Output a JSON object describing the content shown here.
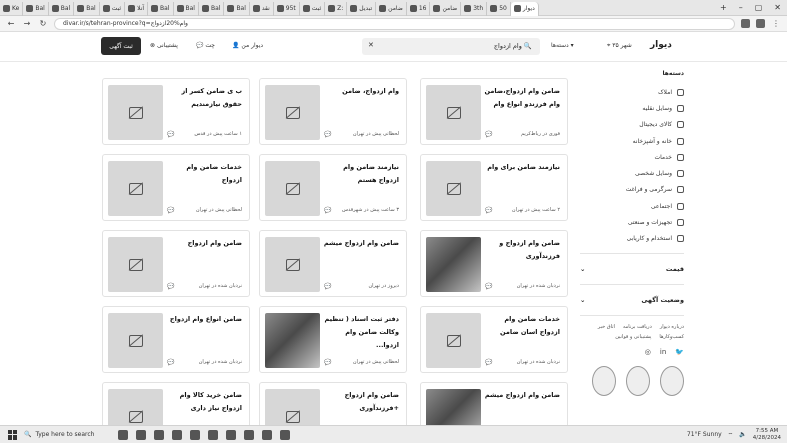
{
  "browser": {
    "tabs": [
      {
        "label": "Ke"
      },
      {
        "label": "Bal"
      },
      {
        "label": "Bal"
      },
      {
        "label": "Bal"
      },
      {
        "label": "ثبت"
      },
      {
        "label": "آنلا"
      },
      {
        "label": "Bal"
      },
      {
        "label": "Bal"
      },
      {
        "label": "Bal"
      },
      {
        "label": "Bal"
      },
      {
        "label": "نقد"
      },
      {
        "label": "95t"
      },
      {
        "label": "ثبت"
      },
      {
        "label": "Z:"
      },
      {
        "label": "تبدیل"
      },
      {
        "label": "ضامن"
      },
      {
        "label": "16"
      },
      {
        "label": "ضامن"
      },
      {
        "label": "3th"
      },
      {
        "label": "50"
      },
      {
        "label": "دیوار"
      }
    ],
    "url": "divar.ir/s/tehran-province?q=وام%20ازدواج"
  },
  "header": {
    "logo": "دیوار",
    "city": "۳۵ شهر",
    "categories": "دسته‌ها",
    "search_query": "وام ازدواج",
    "my_divar": "دیوار من",
    "chat": "چت",
    "support": "پشتیبانی",
    "post_ad": "ثبت آگهی"
  },
  "sidebar": {
    "title": "دسته‌ها",
    "categories": [
      {
        "label": "املاک",
        "icon": "home-icon"
      },
      {
        "label": "وسایل نقلیه",
        "icon": "car-icon"
      },
      {
        "label": "کالای دیجیتال",
        "icon": "phone-icon"
      },
      {
        "label": "خانه و آشپزخانه",
        "icon": "lamp-icon"
      },
      {
        "label": "خدمات",
        "icon": "brush-icon"
      },
      {
        "label": "وسایل شخصی",
        "icon": "watch-icon"
      },
      {
        "label": "سرگرمی و فراغت",
        "icon": "gamepad-icon"
      },
      {
        "label": "اجتماعی",
        "icon": "people-icon"
      },
      {
        "label": "تجهیزات و صنعتی",
        "icon": "chair-icon"
      },
      {
        "label": "استخدام و کاریابی",
        "icon": "briefcase-icon"
      }
    ],
    "filters": [
      {
        "label": "قیمت"
      },
      {
        "label": "وضعیت آگهی"
      }
    ],
    "footer_links": [
      "درباره دیوار",
      "دریافت برنامه",
      "اتاق خبر",
      "کسب‌وکارها",
      "پشتیبانی و قوانین"
    ]
  },
  "cards": [
    {
      "title": "ضامن وام ازدواج،ضامن وام فرزندو انواع وام",
      "meta": "فوری در رباط‌کریم",
      "has_image": false
    },
    {
      "title": "وام ازدواج، ضامن",
      "meta": "لحظاتی پیش در تهران",
      "has_image": false
    },
    {
      "title": "ب ی ضامن کسر از حقوق نیازمندیم",
      "meta": "۱ ساعت پیش در قدس",
      "has_image": false
    },
    {
      "title": "نیازمند ضامن برای وام",
      "meta": "۲ ساعت پیش در تهران",
      "has_image": false
    },
    {
      "title": "نیازمند ضامن وام ازدواج هستم",
      "meta": "۳ ساعت پیش در شهرقدس",
      "has_image": false
    },
    {
      "title": "خدمات ضامن وام ازدواج",
      "meta": "لحظاتی پیش در تهران",
      "has_image": false
    },
    {
      "title": "ضامن وام ازدواج و فرزندآوری",
      "meta": "نردبان شده در تهران",
      "has_image": true
    },
    {
      "title": "ضامن وام ازدواج میشم",
      "meta": "دیروز در تهران",
      "has_image": false
    },
    {
      "title": "ضامن وام ازدواج",
      "meta": "نردبان شده در تهران",
      "has_image": false
    },
    {
      "title": "خدمات ضامن وام ازدواج اسان ضامن",
      "meta": "نردبان شده در تهران",
      "has_image": false
    },
    {
      "title": "دفتر ثبت اسناد ( تنظیم وکالت ضامن وام ازدوا...",
      "meta": "لحظاتی پیش در تهران",
      "has_image": true
    },
    {
      "title": "ضامن انواع وام ازدواج",
      "meta": "نردبان شده در تهران",
      "has_image": false
    },
    {
      "title": "ضامن وام ازدواج میشم",
      "meta": "",
      "has_image": true
    },
    {
      "title": "ضامن وام ازدواج +فرزندآوری",
      "meta": "",
      "has_image": false
    },
    {
      "title": "ضامن خرید کالا وام ازدواج نیاز داری",
      "meta": "",
      "has_image": false
    }
  ],
  "taskbar": {
    "search_placeholder": "Type here to search",
    "weather": "71°F  Sunny",
    "time": "7:55 AM",
    "date": "4/28/2024"
  }
}
